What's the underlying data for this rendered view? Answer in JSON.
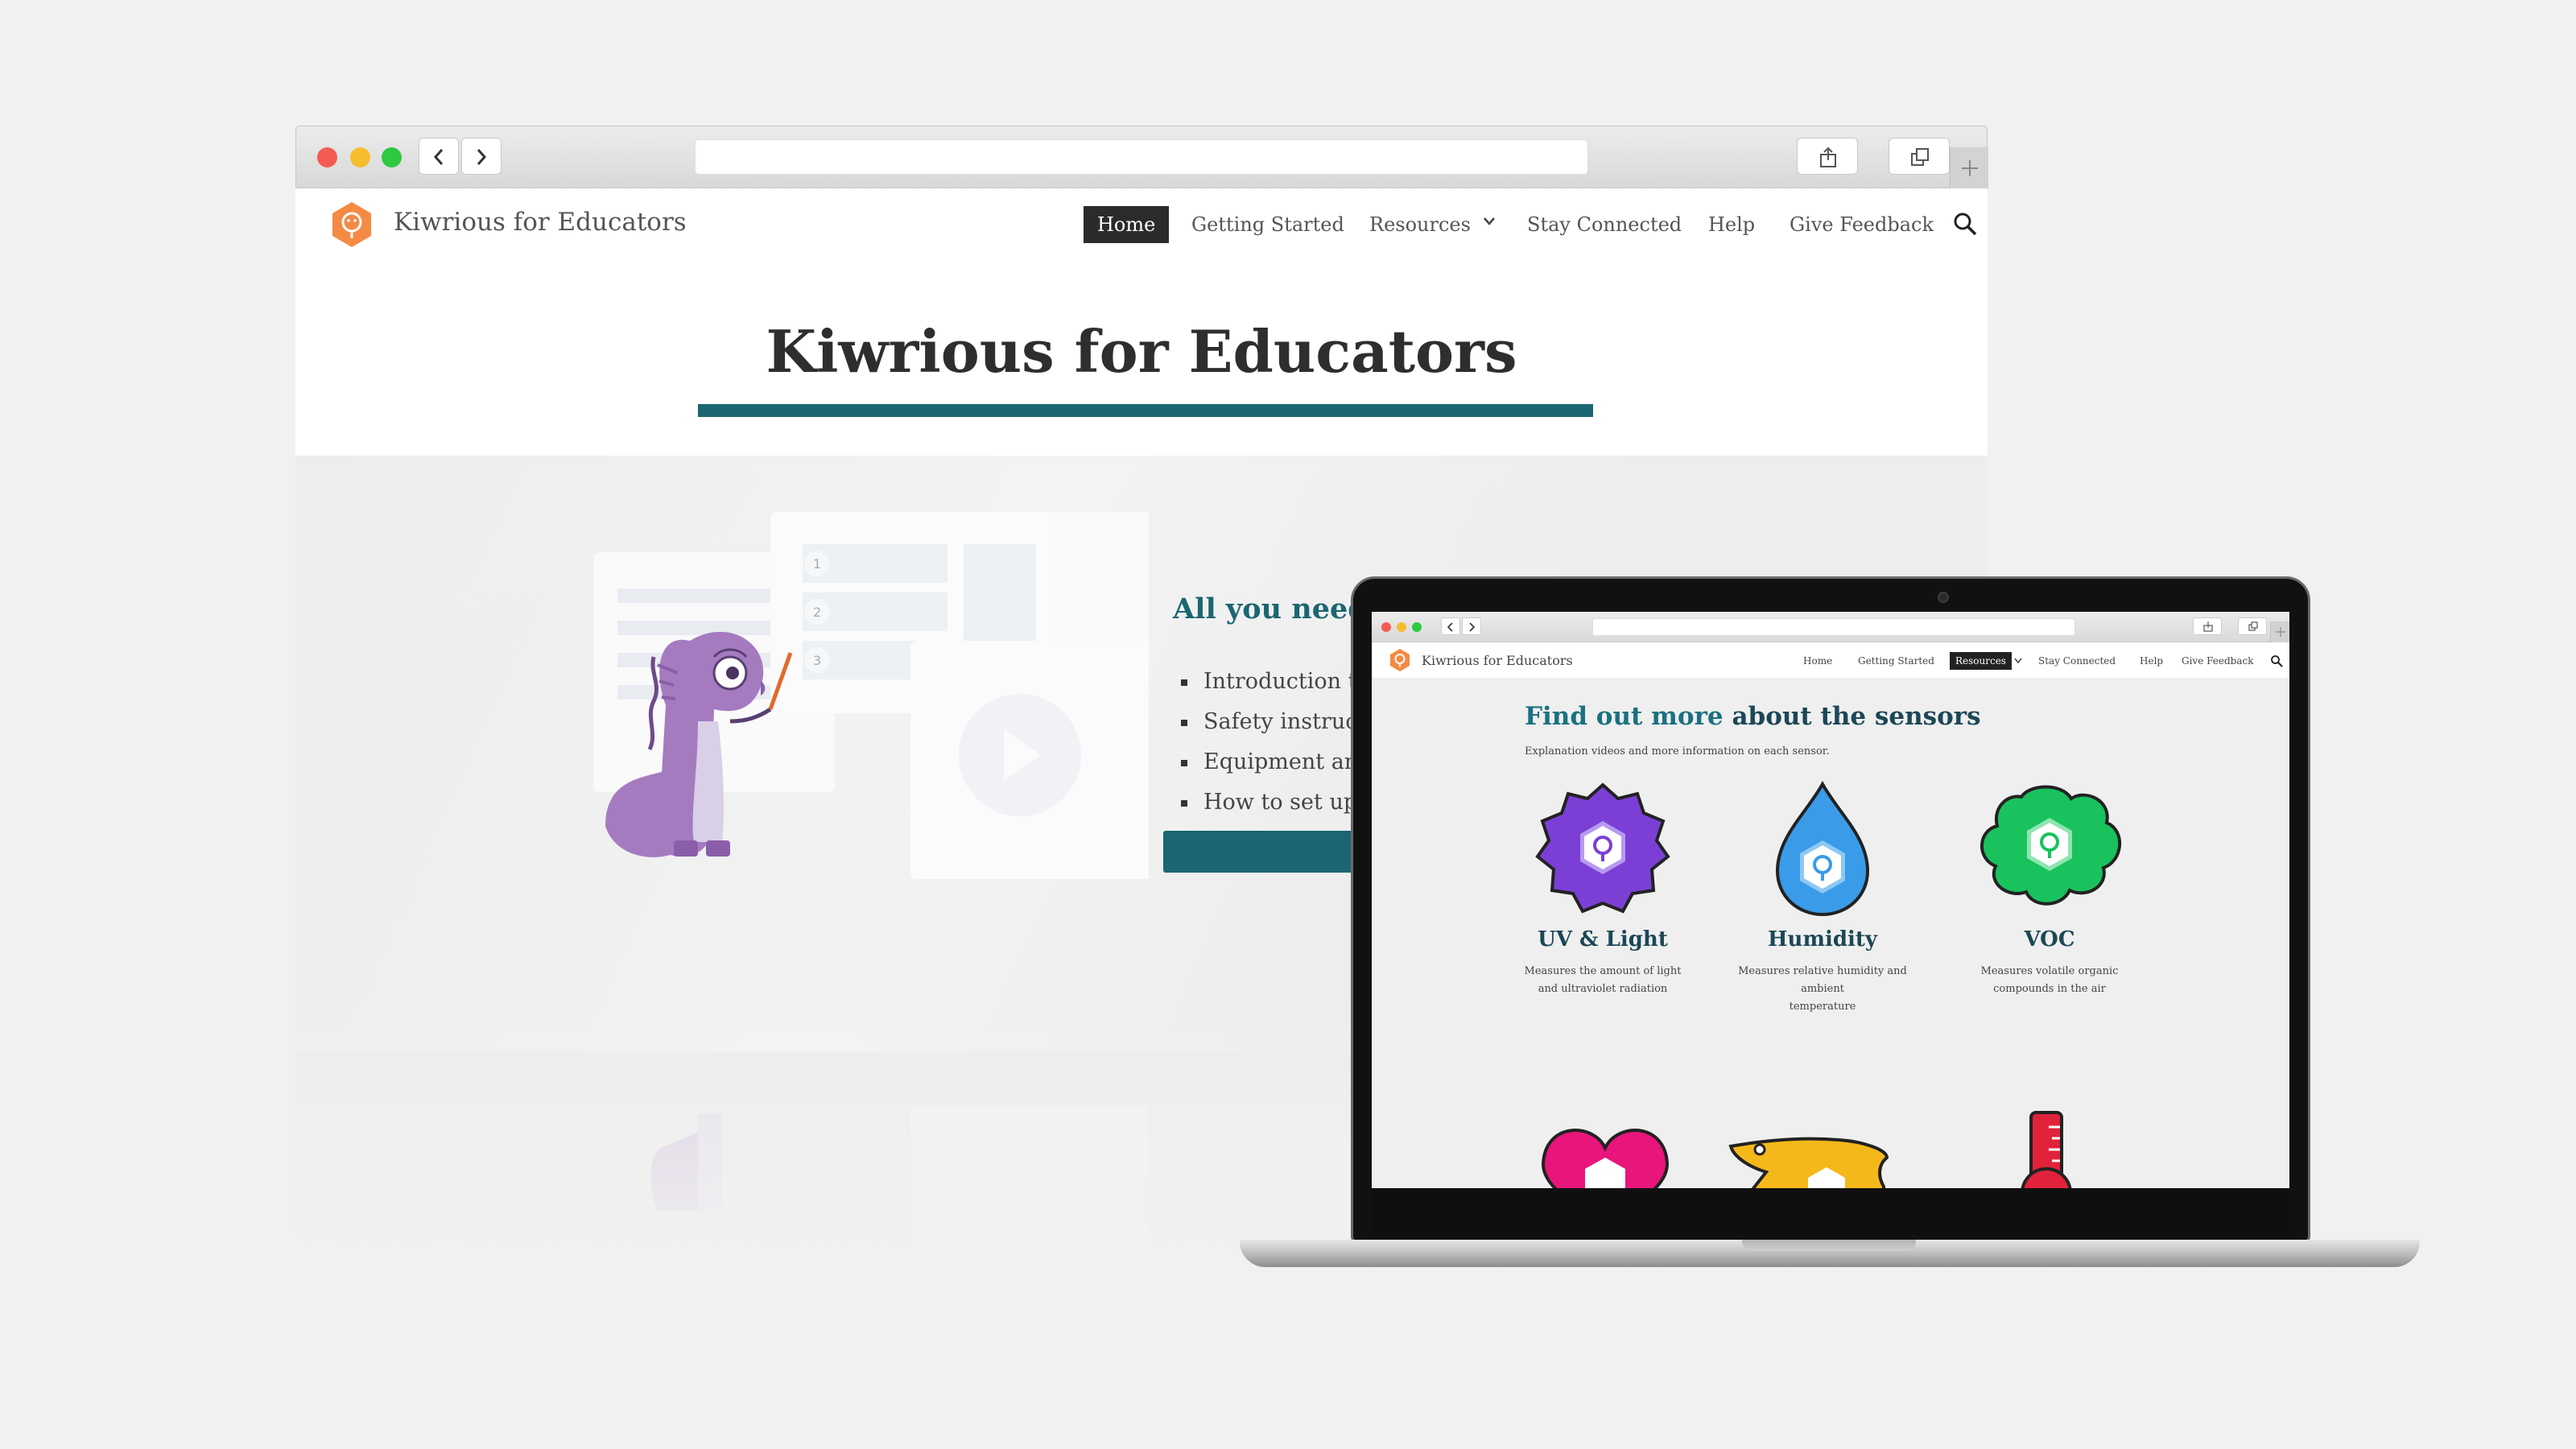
{
  "main_browser": {
    "site_title": "Kiwrious for Educators",
    "nav": [
      {
        "label": "Home",
        "active": true
      },
      {
        "label": "Getting Started"
      },
      {
        "label": "Resources",
        "has_dropdown": true
      },
      {
        "label": "Stay Connected"
      },
      {
        "label": "Help"
      },
      {
        "label": "Give Feedback"
      }
    ],
    "hero_title": "Kiwrious for Educators",
    "section_heading": "All you need t",
    "bullets": [
      "Introduction to",
      "Safety instructio",
      "Equipment and",
      "How to set up yo"
    ],
    "list_numbers": [
      "1",
      "2",
      "3"
    ],
    "accent_color": "#1b6672",
    "brand_color": "#f58a44"
  },
  "laptop_browser": {
    "site_title": "Kiwrious for Educators",
    "nav": [
      {
        "label": "Home"
      },
      {
        "label": "Getting Started"
      },
      {
        "label": "Resources",
        "active": true,
        "has_dropdown": true
      },
      {
        "label": "Stay Connected"
      },
      {
        "label": "Help"
      },
      {
        "label": "Give Feedback"
      }
    ],
    "heading_part1": "Find out more",
    "heading_part2": " about the sensors",
    "subtitle": "Explanation videos and more information on each sensor.",
    "sensors": [
      {
        "name": "UV & Light",
        "desc_line1": "Measures the amount of light",
        "desc_line2": "and ultraviolet radiation",
        "color": "#7b3fd6"
      },
      {
        "name": "Humidity",
        "desc_line1": "Measures relative humidity and ambient",
        "desc_line2": "temperature",
        "color": "#3a9be8"
      },
      {
        "name": "VOC",
        "desc_line1": "Measures volatile organic",
        "desc_line2": "compounds in the air",
        "color": "#19c25d"
      }
    ],
    "partial_sensor_colors": [
      "#e8157a",
      "#f5b81a",
      "#e0233a"
    ]
  }
}
